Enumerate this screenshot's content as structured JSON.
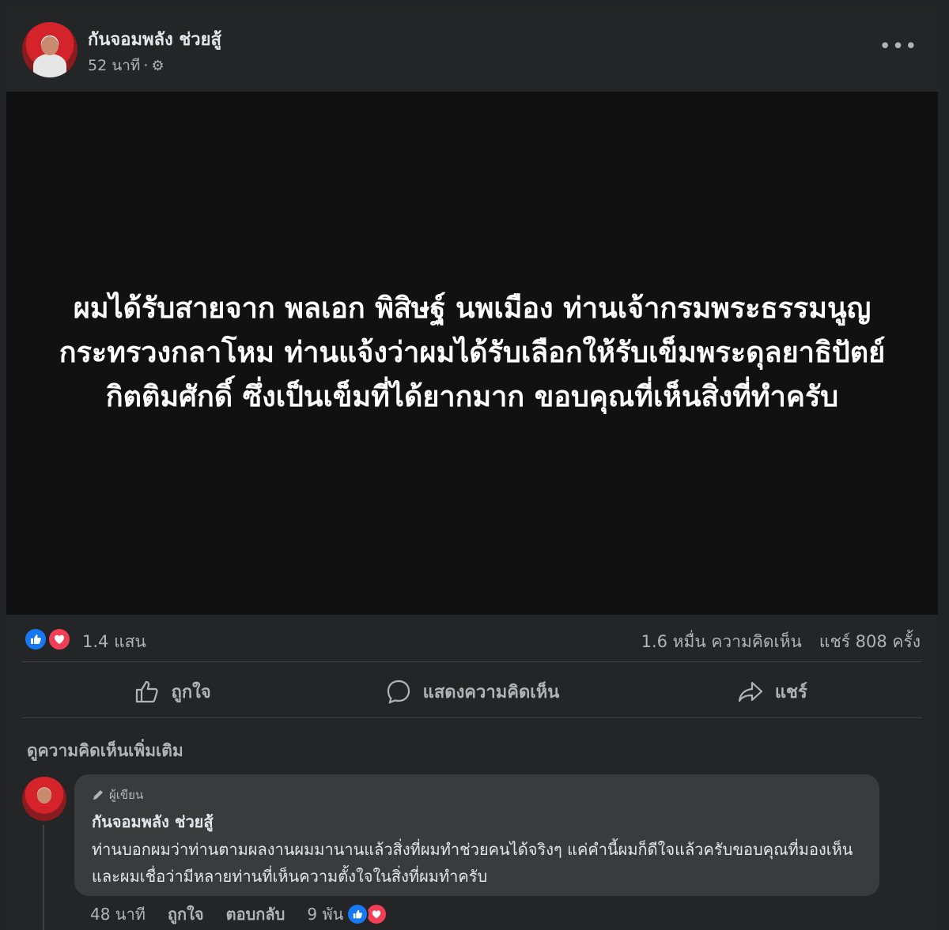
{
  "post": {
    "author": "กันจอมพลัง ช่วยสู้",
    "time": "52 นาที",
    "separator": "·",
    "more_icon": "•••",
    "image_text": "ผมได้รับสายจาก พลเอก พิสิษฐ์ นพเมือง ท่านเจ้ากรมพระธรรมนูญ กระทรวงกลาโหม ท่านแจ้งว่าผมได้รับเลือกให้รับเข็มพระดุลยาธิปัตย์ กิตติมศักดิ์ ซึ่งเป็นเข็มที่ได้ยากมาก ขอบคุณที่เห็นสิ่งที่ทำครับ"
  },
  "reactions": {
    "count": "1.4 แสน",
    "comments": "1.6 หมื่น ความคิดเห็น",
    "shares": "แชร์ 808 ครั้ง"
  },
  "actions": {
    "like": "ถูกใจ",
    "comment": "แสดงความคิดเห็น",
    "share": "แชร์"
  },
  "more_comments": "ดูความคิดเห็นเพิ่มเติม",
  "comment": {
    "badge": "ผู้เขียน",
    "author": "กันจอมพลัง ช่วยสู้",
    "text": "ท่านบอกผมว่าท่านตามผลงานผมมานานแล้วสิ่งที่ผมทำช่วยคนได้จริงๆ แค่คำนี้ผมก็ดีใจแล้วครับขอบคุณที่มองเห็นและผมเชื่อว่ามีหลายท่านที่เห็นความตั้งใจในสิ่งที่ผมทำครับ",
    "time": "48 นาที",
    "like": "ถูกใจ",
    "reply": "ตอบกลับ",
    "reaction_count": "9 พัน"
  },
  "colors": {
    "like_blue": "#1877f2",
    "love_red": "#f33e58",
    "background": "#242526"
  }
}
